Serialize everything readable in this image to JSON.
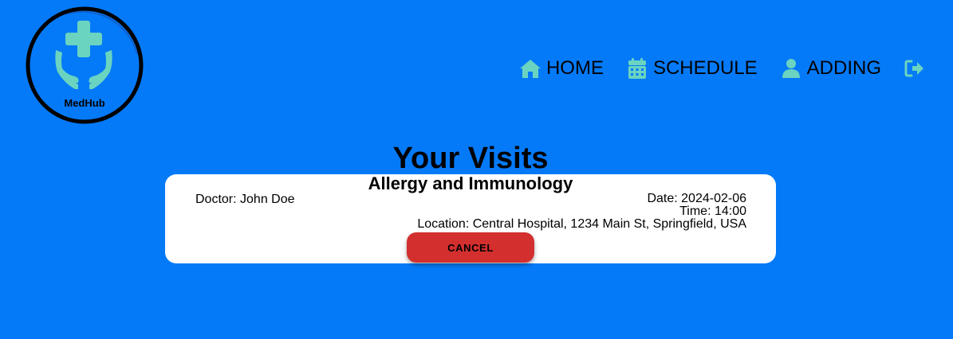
{
  "logo": {
    "text": "MedHub",
    "icon": "medical-cross-hands-icon"
  },
  "nav": {
    "items": [
      {
        "label": "HOME",
        "icon": "home-icon"
      },
      {
        "label": "SCHEDULE",
        "icon": "calendar-icon"
      },
      {
        "label": "ADDING",
        "icon": "user-icon"
      }
    ],
    "logout_icon": "logout-icon"
  },
  "page": {
    "title": "Your Visits"
  },
  "visits": [
    {
      "specialty": "Allergy and Immunology",
      "doctor": "Doctor: John Doe",
      "date": "Date: 2024-02-06",
      "time": "Time: 14:00",
      "location": "Location: Central Hospital, 1234 Main St, Springfield, USA",
      "cancel_label": "CANCEL"
    }
  ],
  "colors": {
    "background": "#057af8",
    "accent": "#6ad4c0",
    "cancel": "#d32f2f",
    "card": "#ffffff"
  }
}
